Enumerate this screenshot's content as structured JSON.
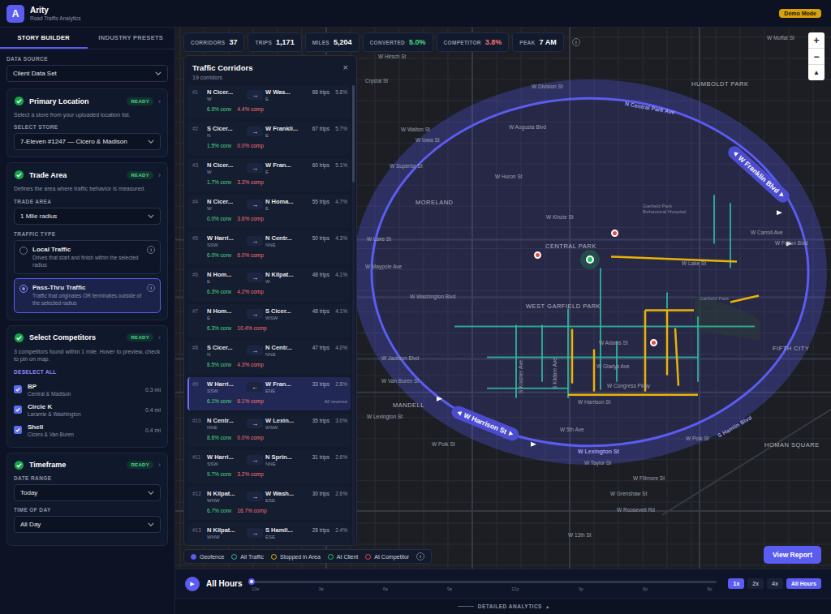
{
  "header": {
    "logo": "A",
    "title": "Arity",
    "subtitle": "Road Traffic Analytics",
    "badge": "Demo Mode"
  },
  "sidebar": {
    "tabs": [
      {
        "label": "STORY BUILDER",
        "selected": true
      },
      {
        "label": "INDUSTRY PRESETS",
        "selected": false
      }
    ],
    "data_source": {
      "label": "DATA SOURCE",
      "value": "Client Data Set"
    },
    "primary_location": {
      "title": "Primary Location",
      "badge": "READY",
      "chevron": "›",
      "done": true,
      "description": "Select a store from your uploaded location list.",
      "field_label": "SELECT STORE",
      "value": "7-Eleven #1247 — Cicero & Madison"
    },
    "trade_area": {
      "title": "Trade Area",
      "badge": "READY",
      "chevron": "›",
      "done": true,
      "description": "Defines the area where traffic behavior is measured.",
      "field_label": "TRADE AREA",
      "value": "1 Mile radius",
      "traffic_type_label": "TRAFFIC TYPE",
      "traffic_types": [
        {
          "label": "Local Traffic",
          "description": "Drives that start and finish within the selected radius",
          "info": "i",
          "selected": false
        },
        {
          "label": "Pass-Thru Traffic",
          "description": "Traffic that originates OR terminates outside of the selected radius",
          "info": "i",
          "selected": true
        }
      ]
    },
    "competitors": {
      "title": "Select Competitors",
      "badge": "READY",
      "chevron": "›",
      "done": true,
      "description": "3 competitors found within 1 mile. Hover to preview, check to pin on map.",
      "action": "DESELECT ALL",
      "items": [
        {
          "name": "BP",
          "location": "Central & Madison",
          "distance": "0.3 mi",
          "checked": true
        },
        {
          "name": "Circle K",
          "location": "Laramie & Washington",
          "distance": "0.4 mi",
          "checked": true
        },
        {
          "name": "Shell",
          "location": "Cicero & Van Buren",
          "distance": "0.4 mi",
          "checked": true
        }
      ]
    },
    "timeframe": {
      "title": "Timeframe",
      "badge": "READY",
      "chevron": "›",
      "done": true,
      "fields": [
        {
          "label": "DATE RANGE",
          "value": "Today"
        },
        {
          "label": "TIME OF DAY",
          "value": "All Day"
        }
      ]
    }
  },
  "stats": [
    {
      "label": "CORRIDORS",
      "value": "37",
      "color": "#ffffff"
    },
    {
      "label": "TRIPS",
      "value": "1,171",
      "color": "#ffffff"
    },
    {
      "label": "MILES",
      "value": "5,204",
      "color": "#ffffff"
    },
    {
      "label": "CONVERTED",
      "value": "5.0%",
      "color": "#4ade80"
    },
    {
      "label": "COMPETITOR",
      "value": "3.8%",
      "color": "#f87171"
    },
    {
      "label": "PEAK",
      "value": "7 AM",
      "color": "#ffffff"
    }
  ],
  "stats_info": "i",
  "corridors_panel": {
    "title": "Traffic Corridors",
    "subtitle": "19 corridors",
    "close": "×",
    "rows": [
      {
        "rank": "#1",
        "from": "N Cicer...",
        "from_dir": "W",
        "arrow": "→",
        "to": "W Was...",
        "to_dir": "E",
        "trips": "68 trips",
        "share": "5.8%",
        "conv": "6.9% conv",
        "comp": "4.4% comp",
        "selected": false
      },
      {
        "rank": "#2",
        "from": "S Cicer...",
        "from_dir": "N",
        "arrow": "→",
        "to": "W Frankli...",
        "to_dir": "E",
        "trips": "67 trips",
        "share": "5.7%",
        "conv": "1.5% conv",
        "comp": "0.0% comp",
        "selected": false
      },
      {
        "rank": "#3",
        "from": "N Cicer...",
        "from_dir": "W",
        "arrow": "→",
        "to": "W Fran...",
        "to_dir": "E",
        "trips": "60 trips",
        "share": "5.1%",
        "conv": "1.7% conv",
        "comp": "3.3% comp",
        "selected": false
      },
      {
        "rank": "#4",
        "from": "N Cicer...",
        "from_dir": "W",
        "arrow": "→",
        "to": "N Homa...",
        "to_dir": "E",
        "trips": "55 trips",
        "share": "4.7%",
        "conv": "0.0% conv",
        "comp": "3.6% comp",
        "selected": false
      },
      {
        "rank": "#5",
        "from": "W Harri...",
        "from_dir": "SSW",
        "arrow": "→",
        "to": "N Centr...",
        "to_dir": "NNE",
        "trips": "50 trips",
        "share": "4.3%",
        "conv": "6.0% conv",
        "comp": "6.0% comp",
        "selected": false
      },
      {
        "rank": "#6",
        "from": "N Hom...",
        "from_dir": "E",
        "arrow": "→",
        "to": "N Kilpat...",
        "to_dir": "W",
        "trips": "48 trips",
        "share": "4.1%",
        "conv": "6.3% conv",
        "comp": "4.2% comp",
        "selected": false
      },
      {
        "rank": "#7",
        "from": "N Hom...",
        "from_dir": "E",
        "arrow": "→",
        "to": "S Cicer...",
        "to_dir": "WSW",
        "trips": "48 trips",
        "share": "4.1%",
        "conv": "6.3% conv",
        "comp": "10.4% comp",
        "selected": false
      },
      {
        "rank": "#8",
        "from": "S Cicer...",
        "from_dir": "N",
        "arrow": "→",
        "to": "N Centr...",
        "to_dir": "NNE",
        "trips": "47 trips",
        "share": "4.0%",
        "conv": "8.5% conv",
        "comp": "4.3% comp",
        "selected": false
      },
      {
        "rank": "#9",
        "from": "W Harri...",
        "from_dir": "SSW",
        "arrow": "←",
        "to": "W Fran...",
        "to_dir": "ENE",
        "trips": "33 trips",
        "share": "2.8%",
        "conv": "6.1% conv",
        "comp": "6.1% comp",
        "reverse": "42 reverse",
        "selected": true
      },
      {
        "rank": "#10",
        "from": "N Centr...",
        "from_dir": "NNE",
        "arrow": "→",
        "to": "W Lexin...",
        "to_dir": "WSW",
        "trips": "35 trips",
        "share": "3.0%",
        "conv": "8.6% conv",
        "comp": "0.0% comp",
        "selected": false
      },
      {
        "rank": "#11",
        "from": "W Harri...",
        "from_dir": "SSW",
        "arrow": "→",
        "to": "N Sprin...",
        "to_dir": "NNE",
        "trips": "31 trips",
        "share": "2.6%",
        "conv": "9.7% conv",
        "comp": "3.2% comp",
        "selected": false
      },
      {
        "rank": "#12",
        "from": "N Kilpat...",
        "from_dir": "WNW",
        "arrow": "→",
        "to": "W Wash...",
        "to_dir": "ESE",
        "trips": "30 trips",
        "share": "2.6%",
        "conv": "6.7% conv",
        "comp": "16.7% comp",
        "selected": false
      },
      {
        "rank": "#13",
        "from": "N Kilpat...",
        "from_dir": "WNW",
        "arrow": "→",
        "to": "S Hamli...",
        "to_dir": "ESE",
        "trips": "28 trips",
        "share": "2.4%",
        "selected": false
      }
    ]
  },
  "map": {
    "labels": [
      {
        "text": "W Moffat St",
        "kind": "street"
      },
      {
        "text": "W Hirsch St",
        "kind": "street"
      },
      {
        "text": "Crystal St",
        "kind": "street"
      },
      {
        "text": "W Division St",
        "kind": "street"
      },
      {
        "text": "HUMBOLDT PARK",
        "kind": "area"
      },
      {
        "text": "W Walton St",
        "kind": "street"
      },
      {
        "text": "W Iowa St",
        "kind": "street"
      },
      {
        "text": "W Augusta Blvd",
        "kind": "street"
      },
      {
        "text": "W Superior St",
        "kind": "street"
      },
      {
        "text": "W Huron St",
        "kind": "street"
      },
      {
        "text": "MORELAND",
        "kind": "area"
      },
      {
        "text": "Garfield Park Behavioral Hospital",
        "kind": "park"
      },
      {
        "text": "W Kinzie St",
        "kind": "street"
      },
      {
        "text": "W Carroll Ave",
        "kind": "street"
      },
      {
        "text": "W Lake St",
        "kind": "street"
      },
      {
        "text": "W Fulton Blvd",
        "kind": "street"
      },
      {
        "text": "CENTRAL PARK",
        "kind": "area"
      },
      {
        "text": "W Lake St",
        "kind": "street"
      },
      {
        "text": "W Maypole Ave",
        "kind": "street"
      },
      {
        "text": "W Washington Blvd",
        "kind": "street"
      },
      {
        "text": "Garfield Park",
        "kind": "park"
      },
      {
        "text": "WEST GARFIELD PARK",
        "kind": "area"
      },
      {
        "text": "W Adams St",
        "kind": "street"
      },
      {
        "text": "FIFTH CITY",
        "kind": "area"
      },
      {
        "text": "W Jackson Blvd",
        "kind": "street"
      },
      {
        "text": "W Gladys Ave",
        "kind": "street"
      },
      {
        "text": "W Van Buren St",
        "kind": "street"
      },
      {
        "text": "W Congress Pkwy",
        "kind": "street"
      },
      {
        "text": "W Harrison St",
        "kind": "street"
      },
      {
        "text": "MANDELL",
        "kind": "area"
      },
      {
        "text": "W Lexington St",
        "kind": "street"
      },
      {
        "text": "W 5th Ave",
        "kind": "street"
      },
      {
        "text": "W Polk St",
        "kind": "street"
      },
      {
        "text": "W Polk St",
        "kind": "street"
      },
      {
        "text": "HOMAN SQUARE",
        "kind": "area"
      },
      {
        "text": "W Taylor St",
        "kind": "street"
      },
      {
        "text": "W Fillmore St",
        "kind": "street"
      },
      {
        "text": "W Grenshaw St",
        "kind": "street"
      },
      {
        "text": "W Roosevelt Rd",
        "kind": "street"
      },
      {
        "text": "W 13th St",
        "kind": "street"
      },
      {
        "text": "S Kostner Ave",
        "kind": "street"
      },
      {
        "text": "S Kildare Ave",
        "kind": "street"
      },
      {
        "text": "N Central Park Ave",
        "kind": "ring"
      },
      {
        "text": "W Lexington St",
        "kind": "ring"
      },
      {
        "text": "S Hamlin Blvd",
        "kind": "ring"
      }
    ],
    "ring_badges": [
      {
        "label": "W Franklin Blvd"
      },
      {
        "label": "W Harrison St"
      }
    ]
  },
  "legend": {
    "items": [
      {
        "label": "Geofence",
        "color": "#5b5cf0",
        "kind": "filled"
      },
      {
        "label": "All Traffic",
        "color": "#2fb8a0",
        "kind": "ring"
      },
      {
        "label": "Stopped in Area",
        "color": "#eab308",
        "kind": "ring"
      },
      {
        "label": "At Client",
        "color": "#22c55e",
        "kind": "ring"
      },
      {
        "label": "At Competitor",
        "color": "#ef4444",
        "kind": "ring"
      }
    ],
    "info": "i"
  },
  "zoom": {
    "in": "+",
    "out": "−",
    "compass": "▲"
  },
  "view_report": "View Report",
  "timeline": {
    "play": "▶",
    "label": "All Hours",
    "level": 0,
    "ticks": [
      "12a",
      "3a",
      "6a",
      "9a",
      "12p",
      "3p",
      "6p",
      "9p"
    ],
    "speeds": [
      {
        "label": "1x",
        "selected": true
      },
      {
        "label": "2x",
        "selected": false
      },
      {
        "label": "4x",
        "selected": false
      },
      {
        "label": "All Hours",
        "selected": true
      }
    ]
  },
  "footer": {
    "label": "DETAILED ANALYTICS",
    "chevron": "▴"
  }
}
